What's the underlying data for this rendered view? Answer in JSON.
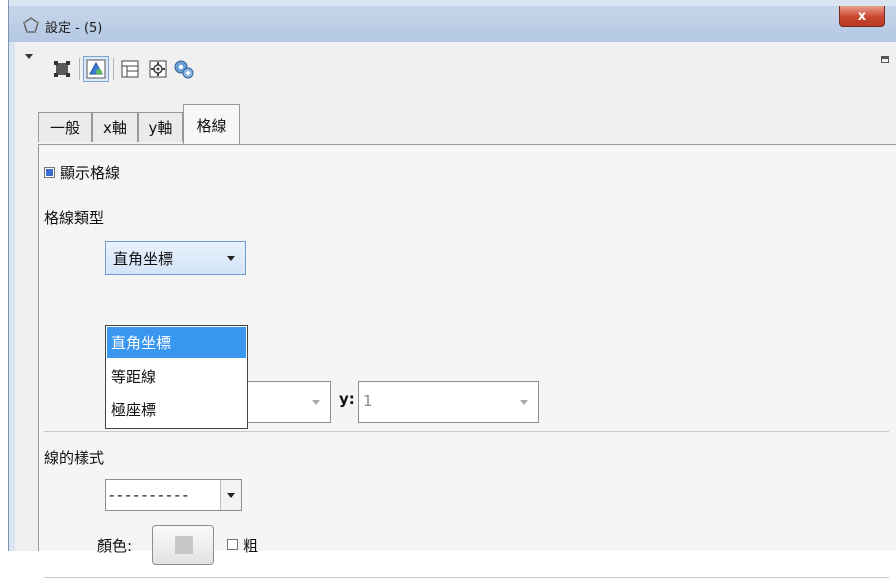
{
  "window": {
    "title": "設定 - (5)",
    "close_label": "x"
  },
  "toolbar": {
    "icons": [
      "graphics-icon",
      "graphics2-icon",
      "layout-icon",
      "defaults-icon",
      "advanced-settings-icon"
    ],
    "selected": "graphics2-icon"
  },
  "tabs": [
    {
      "label": "一般"
    },
    {
      "label": "x軸"
    },
    {
      "label": "y軸"
    },
    {
      "label": "格線",
      "active": true
    }
  ],
  "grid": {
    "show_label": "顯示格線",
    "show_checked": true,
    "type_label": "格線類型",
    "type_value": "直角坐標",
    "type_options": [
      "直角坐標",
      "等距線",
      "極座標"
    ],
    "x_value": "",
    "y_label": "y:",
    "y_value": "1"
  },
  "line_style": {
    "label": "線的樣式",
    "value": "- - - - - - - - - -",
    "color_label": "顏色:",
    "bold_label": "粗",
    "bold_checked": false
  }
}
